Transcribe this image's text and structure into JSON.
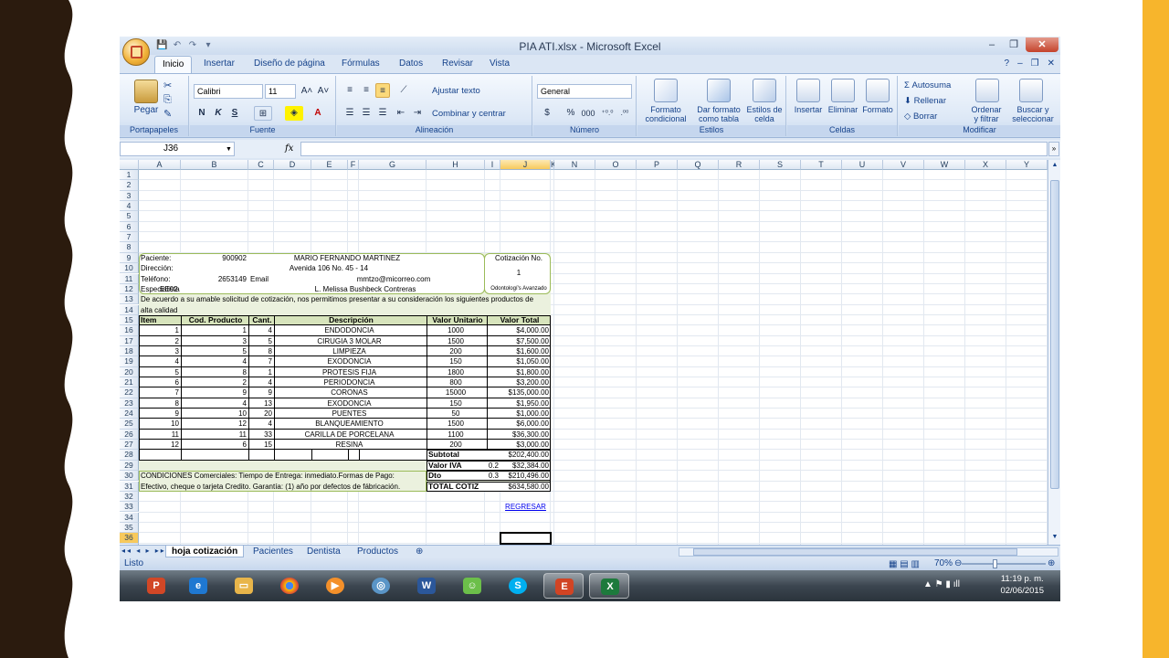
{
  "window": {
    "title": "PIA ATI.xlsx - Microsoft Excel",
    "controls": [
      "–",
      "❐",
      "✕"
    ],
    "quick_access": [
      "💾",
      "↶",
      "↷",
      "▾"
    ]
  },
  "tabs": [
    "Inicio",
    "Insertar",
    "Diseño de página",
    "Fórmulas",
    "Datos",
    "Revisar",
    "Vista"
  ],
  "tab_helpers": [
    "?",
    "–",
    "❐",
    "✕"
  ],
  "ribbon": {
    "clipboard": {
      "label": "Portapapeles",
      "paste": "Pegar"
    },
    "font": {
      "label": "Fuente",
      "font_name": "Calibri",
      "font_size": "11",
      "grow": "A˄",
      "shrink": "A˅",
      "bold": "N",
      "italic": "K",
      "underline": "S"
    },
    "alignment": {
      "label": "Alineación",
      "wrap_text": "Ajustar texto",
      "merge_center": "Combinar y centrar"
    },
    "number": {
      "label": "Número",
      "format": "General",
      "currency": "$",
      "percent": "%",
      "thousands": "000",
      "inc_dec": "⁺⁰.⁰",
      "dec_dec": ".⁰⁰"
    },
    "styles": {
      "label": "Estilos",
      "cond_format_1": "Formato",
      "cond_format_2": "condicional",
      "format_table_1": "Dar formato",
      "format_table_2": "como tabla",
      "cell_styles_1": "Estilos de",
      "cell_styles_2": "celda"
    },
    "cells": {
      "label": "Celdas",
      "insert": "Insertar",
      "delete": "Eliminar",
      "format": "Formato"
    },
    "editing": {
      "label": "Modificar",
      "autosum": "Autosuma",
      "fill": "Rellenar",
      "clear": "Borrar",
      "sort_1": "Ordenar",
      "sort_2": "y filtrar",
      "find_1": "Buscar y",
      "find_2": "seleccionar"
    }
  },
  "formula_bar": {
    "name_box": "J36",
    "fx": "fx",
    "value": ""
  },
  "columns": [
    "A",
    "B",
    "C",
    "D",
    "E",
    "F",
    "G",
    "H",
    "I",
    "J",
    "K",
    "N",
    "O",
    "P",
    "Q",
    "R",
    "S",
    "T",
    "U",
    "V",
    "W",
    "X",
    "Y"
  ],
  "rows": [
    "1",
    "2",
    "3",
    "4",
    "5",
    "6",
    "7",
    "8",
    "9",
    "10",
    "11",
    "12",
    "13",
    "14",
    "15",
    "16",
    "17",
    "18",
    "19",
    "20",
    "21",
    "22",
    "23",
    "24",
    "25",
    "26",
    "27",
    "28",
    "29",
    "30",
    "31",
    "32",
    "33",
    "34",
    "35",
    "36",
    "37"
  ],
  "info": {
    "paciente_label": "Paciente:",
    "paciente_id": "900902",
    "paciente_nombre": "MARIO FERNANDO MARTINEZ",
    "direccion_label": "Dirección:",
    "direccion": "Avenida 106 No. 45 - 14",
    "telefono_label": "Teléfono:",
    "telefono": "2653149",
    "email_label": "Email",
    "email": "mmtzo@micorreo.com",
    "especialista_label": "Especialista",
    "especialista_code": "EE02",
    "especialista_nombre": "L. Melissa Bushbeck Contreras",
    "cotizacion_label": "Cotización No.",
    "cotizacion_no": "1",
    "especialidad": "Odontologí's Avanzado",
    "intro_1": "De acuerdo a su amable solicitud de cotización, nos permitimos presentar a su consideración los siguientes productos de",
    "intro_2": "alta calidad"
  },
  "table": {
    "headers": [
      "Item",
      "Cod. Producto",
      "Cant.",
      "Descripción",
      "Valor Unitario",
      "Valor Total"
    ],
    "rows": [
      [
        "1",
        "1",
        "4",
        "ENDODONCIA",
        "1000",
        "$4,000.00"
      ],
      [
        "2",
        "3",
        "5",
        "CIRUGIA 3 MOLAR",
        "1500",
        "$7,500.00"
      ],
      [
        "3",
        "5",
        "8",
        "LIMPIEZA",
        "200",
        "$1,600.00"
      ],
      [
        "4",
        "4",
        "7",
        "EXODONCIA",
        "150",
        "$1,050.00"
      ],
      [
        "5",
        "8",
        "1",
        "PROTESIS FIJA",
        "1800",
        "$1,800.00"
      ],
      [
        "6",
        "2",
        "4",
        "PERIODONCIA",
        "800",
        "$3,200.00"
      ],
      [
        "7",
        "9",
        "9",
        "CORONAS",
        "15000",
        "$135,000.00"
      ],
      [
        "8",
        "4",
        "13",
        "EXODONCIA",
        "150",
        "$1,950.00"
      ],
      [
        "9",
        "10",
        "20",
        "PUENTES",
        "50",
        "$1,000.00"
      ],
      [
        "10",
        "12",
        "4",
        "BLANQUEAMIENTO",
        "1500",
        "$6,000.00"
      ],
      [
        "11",
        "11",
        "33",
        "CARILLA DE PORCELANA",
        "1100",
        "$36,300.00"
      ],
      [
        "12",
        "6",
        "15",
        "RESINA",
        "200",
        "$3,000.00"
      ]
    ],
    "subtotal_label": "Subtotal",
    "subtotal": "$202,400.00",
    "iva_label": "Valor IVA",
    "iva_rate": "0.2",
    "iva": "$32,384.00",
    "dto_label": "Dto",
    "dto_rate": "0.3",
    "dto": "$210,496.00",
    "total_label": "TOTAL COTIZ",
    "total": "$634,580.00"
  },
  "conditions": {
    "line_1": "CONDICIONES Comerciales: Tiempo de Entrega: inmediato.Formas de Pago:",
    "line_2": "Efectivo, cheque o tarjeta Credito. Garantía: (1) año por defectos de fábricación."
  },
  "link": "REGRESAR",
  "sheet_tabs": [
    "hoja cotización",
    "Pacientes",
    "Dentista",
    "Productos"
  ],
  "status": {
    "ready": "Listo",
    "zoom": "70%"
  },
  "taskbar": {
    "time": "11:19 p. m.",
    "date": "02/06/2015"
  },
  "colors": {
    "accent_bar": "#f7b52c",
    "left_wave": "#2b1b0e",
    "table_green": "#ebf1de",
    "link": "#0000ee"
  }
}
